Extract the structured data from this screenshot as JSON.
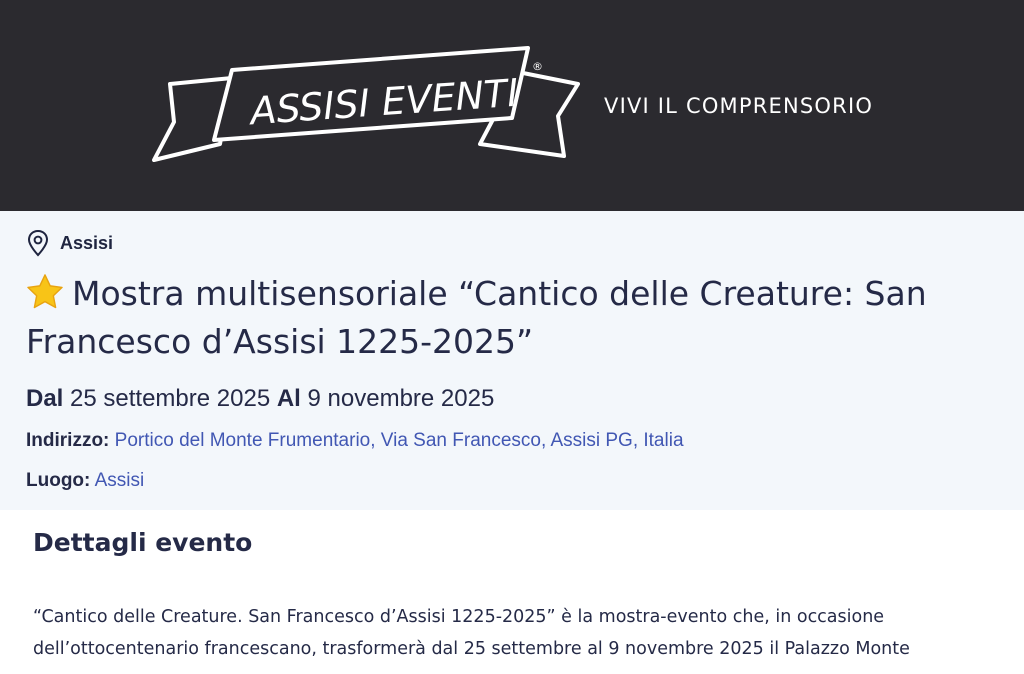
{
  "header": {
    "logo_text": "ASSISI EVENTI",
    "logo_mark": "®",
    "tagline": "VIVI IL COMPRENSORIO",
    "background_color": "#2b2a2f"
  },
  "event": {
    "location_icon": "map-pin-icon",
    "location": "Assisi",
    "title_icon": "star-icon",
    "title": "Mostra multisensoriale “Cantico delle Creature: San Francesco d’Assisi 1225-2025”",
    "date_from_label": "Dal",
    "date_from": "25 settembre 2025",
    "date_to_label": "Al",
    "date_to": "9 novembre 2025",
    "address_label": "Indirizzo:",
    "address": "Portico del Monte Frumentario, Via San Francesco, Assisi PG, Italia",
    "place_label": "Luogo:",
    "place": "Assisi",
    "link_color": "#4157b3"
  },
  "details": {
    "heading": "Dettagli evento",
    "paragraph_line1": "“Cantico delle Creature. San Francesco d’Assisi 1225-2025” è la mostra-evento che, in occasione",
    "paragraph_line2": "dell’ottocentenario francescano, trasformerà dal 25 settembre al 9 novembre 2025 il Palazzo Monte"
  }
}
